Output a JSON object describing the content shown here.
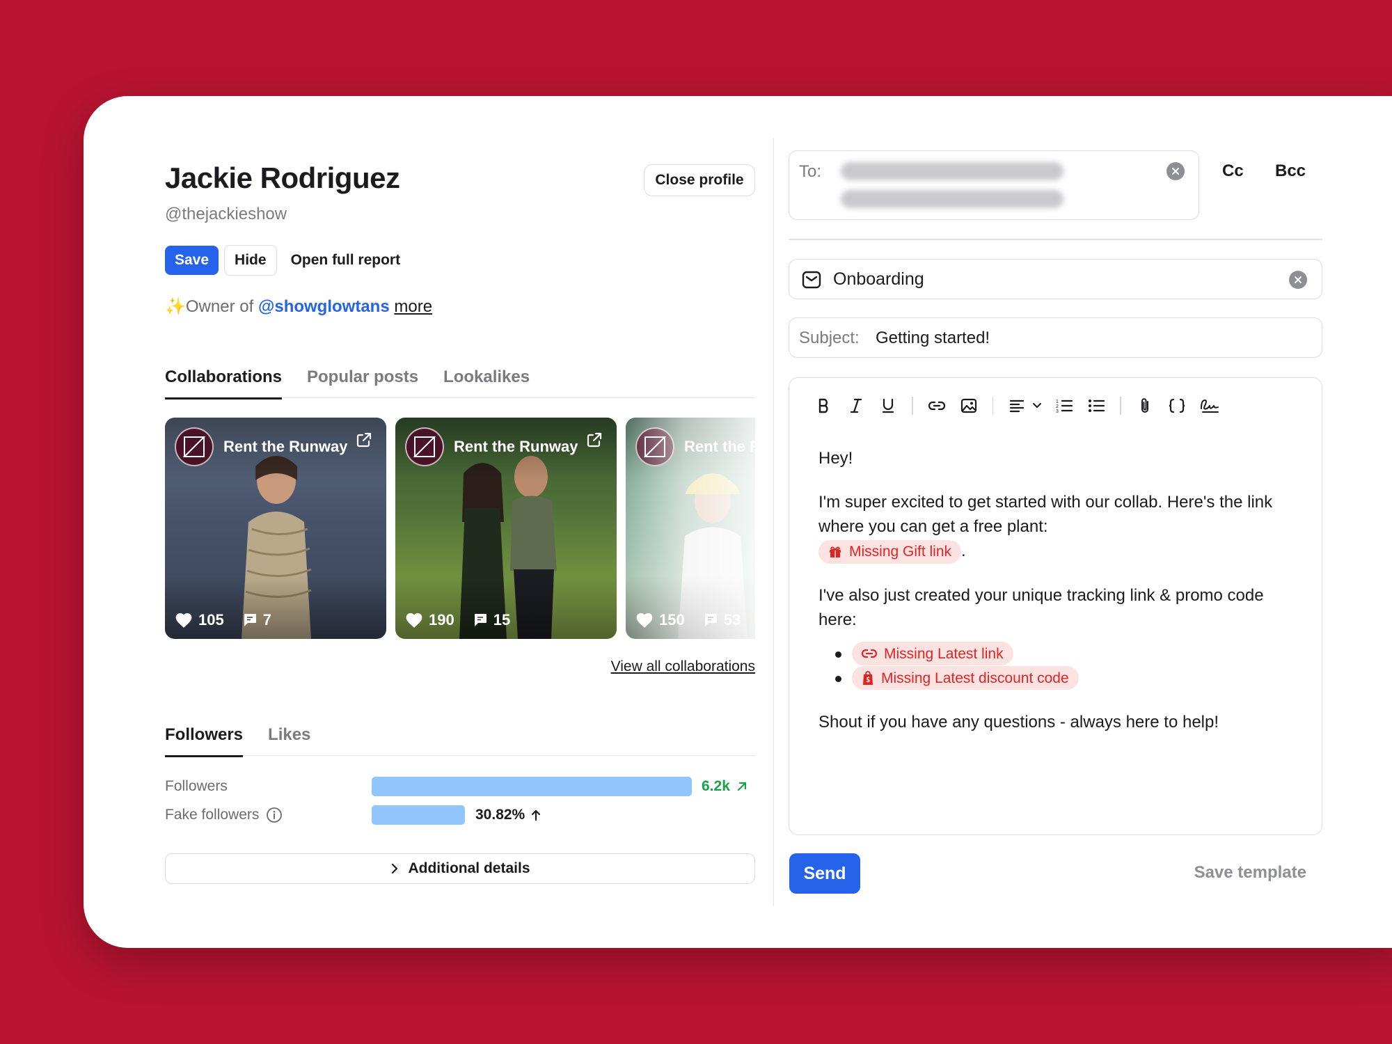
{
  "profile": {
    "name": "Jackie Rodriguez",
    "handle": "@thejackieshow",
    "close_label": "Close profile",
    "save_label": "Save",
    "hide_label": "Hide",
    "report_label": "Open full report",
    "bio_prefix": "Owner of",
    "bio_mention": "@showglowtans",
    "bio_more": "more"
  },
  "tabs": [
    "Collaborations",
    "Popular posts",
    "Lookalikes"
  ],
  "collaborations": [
    {
      "brand": "Rent the Runway",
      "likes": "105",
      "comments": "7"
    },
    {
      "brand": "Rent the Runway",
      "likes": "190",
      "comments": "15"
    },
    {
      "brand": "Rent the R",
      "likes": "150",
      "comments": "53"
    }
  ],
  "view_all_label": "View all collaborations",
  "audience_tabs": [
    "Followers",
    "Likes"
  ],
  "metrics": {
    "followers": {
      "label": "Followers",
      "value": "6.2k",
      "bar_fraction": 1.0
    },
    "fake_followers": {
      "label": "Fake followers",
      "value": "30.82%",
      "bar_fraction": 0.2914
    }
  },
  "additional_label": "Additional details",
  "email": {
    "to_label": "To:",
    "cc_label": "Cc",
    "bcc_label": "Bcc",
    "template": "Onboarding",
    "subject_label": "Subject:",
    "subject": "Getting started!",
    "body": {
      "greeting": "Hey!",
      "para1": "I'm super excited to get started with our collab. Here's the link where you can get a free plant:",
      "gift_pill": "Missing Gift link",
      "para2": "I've also just created your unique tracking link & promo code here:",
      "link_pill": "Missing Latest link",
      "discount_pill": "Missing Latest discount code",
      "closing": "Shout if you have any questions - always here to help!"
    },
    "send_label": "Send",
    "save_template_label": "Save template"
  },
  "colors": {
    "background": "#B81430",
    "accent": "#2563EB",
    "bar": "#93C5FD",
    "positive": "#16A34A",
    "missing_pill_bg": "#FDE2E2",
    "missing_pill_text": "#DC2626"
  },
  "icons": [
    "external-link-icon",
    "heart-icon",
    "comment-icon",
    "mail-icon",
    "clear-icon",
    "info-icon",
    "arrow-up-right-icon",
    "arrow-up-icon",
    "chevron-right-icon",
    "bold-icon",
    "italic-icon",
    "underline-icon",
    "link-icon",
    "image-icon",
    "align-icon",
    "chevron-down-icon",
    "ordered-list-icon",
    "bullet-list-icon",
    "attachment-icon",
    "code-braces-icon",
    "signature-icon",
    "gift-icon",
    "shopify-bag-icon"
  ]
}
